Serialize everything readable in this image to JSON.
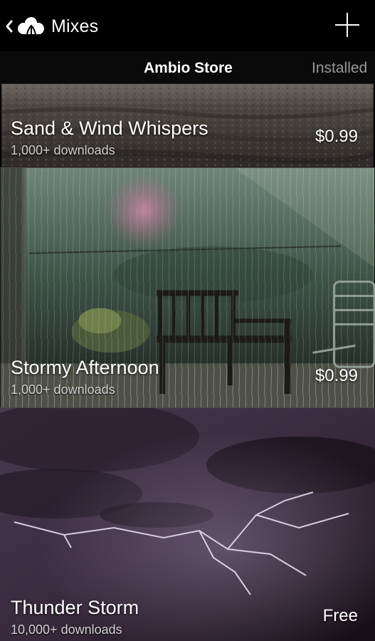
{
  "header": {
    "title": "Mixes",
    "back_icon": "chevron-left-icon",
    "logo_icon": "ambio-cloud-logo",
    "add_icon": "plus-icon"
  },
  "tabs": {
    "store": "Ambio Store",
    "installed": "Installed",
    "active": "store"
  },
  "mixes": [
    {
      "name": "Sand & Wind Whispers",
      "downloads": "1,000+ downloads",
      "price": "$0.99"
    },
    {
      "name": "Stormy Afternoon",
      "downloads": "1,000+ downloads",
      "price": "$0.99"
    },
    {
      "name": "Thunder Storm",
      "downloads": "10,000+ downloads",
      "price": "Free"
    }
  ],
  "colors": {
    "background": "#000000",
    "tab_inactive": "#9a9a9a",
    "thunder_sky": "#3a2a3e",
    "storm_green": "#3f5a48",
    "sand": "#4a4440"
  }
}
